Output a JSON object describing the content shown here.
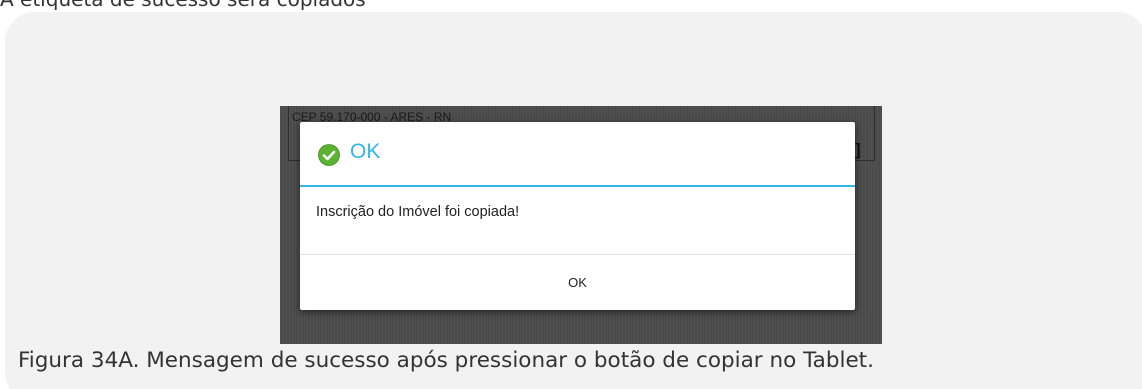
{
  "previous_text": "A etiqueta de sucesso sera copiados",
  "screenshot": {
    "background_address": "CEP 59.170-000 - ARES - RN",
    "background_bracket": "]"
  },
  "dialog": {
    "icon": "check-circle-icon",
    "title": "OK",
    "message": "Inscrição do Imóvel foi copiada!",
    "button_label": "OK",
    "accent_color": "#33b5e5",
    "icon_color": "#5bb132"
  },
  "caption": "Figura 34A. Mensagem de sucesso após pressionar o botão de copiar no Tablet."
}
